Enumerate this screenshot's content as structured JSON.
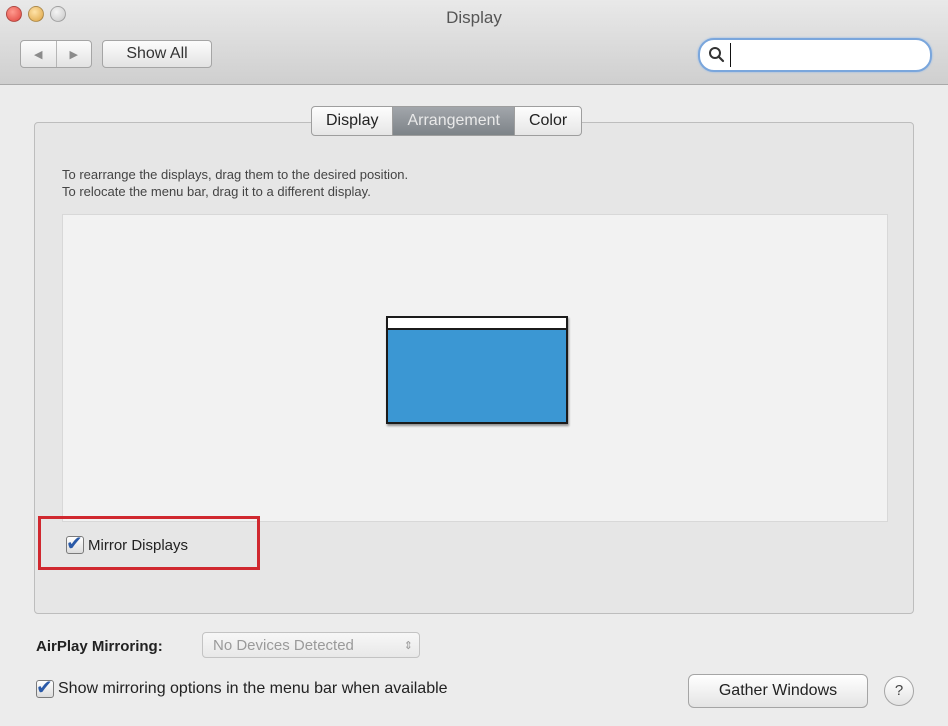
{
  "window": {
    "title": "Display"
  },
  "toolbar": {
    "back_glyph": "◀",
    "forward_glyph": "▶",
    "show_all_label": "Show All",
    "search_value": "",
    "search_placeholder": ""
  },
  "tabs": [
    {
      "label": "Display",
      "active": false
    },
    {
      "label": "Arrangement",
      "active": true
    },
    {
      "label": "Color",
      "active": false
    }
  ],
  "arrangement": {
    "instruction_line1": "To rearrange the displays, drag them to the desired position.",
    "instruction_line2": "To relocate the menu bar, drag it to a different display.",
    "display_color": "#3b97d3"
  },
  "mirror": {
    "label": "Mirror Displays",
    "checked": true,
    "highlight_color": "#d0282f"
  },
  "airplay": {
    "label": "AirPlay Mirroring:",
    "selected": "No Devices Detected"
  },
  "show_mirroring": {
    "label": "Show mirroring options in the menu bar when available",
    "checked": true
  },
  "buttons": {
    "gather_windows": "Gather Windows",
    "help": "?"
  },
  "icons": {
    "search": "search-icon",
    "checkmark": "✔",
    "select_arrows": "⇕"
  }
}
